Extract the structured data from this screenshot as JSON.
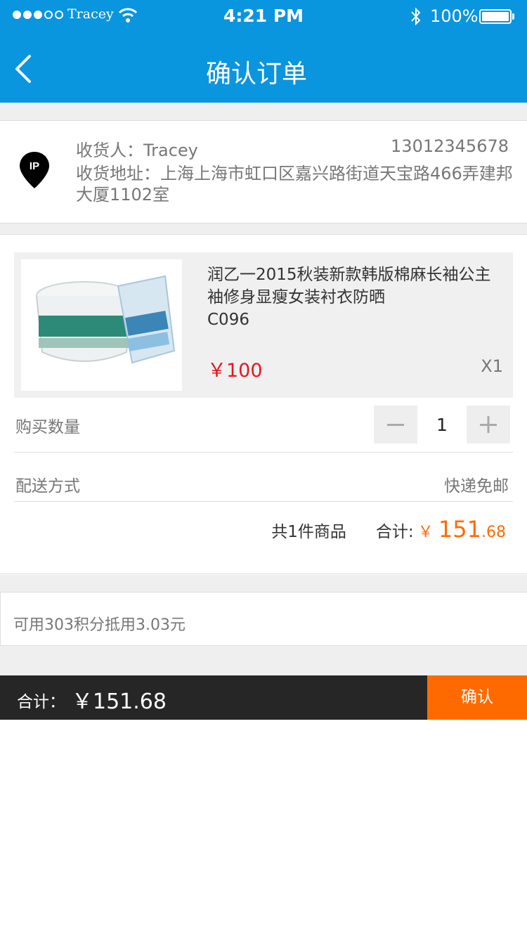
{
  "status_bar": {
    "carrier": "Tracey",
    "time": "4:21 PM",
    "battery": "100%",
    "signal_bars": 3,
    "icons": [
      "signal-icon",
      "wifi-icon",
      "bluetooth-icon",
      "battery-icon"
    ]
  },
  "nav": {
    "title": "确认订单",
    "back_icon": "chevron-left-icon"
  },
  "address": {
    "recipient": "收货人：Tracey",
    "phone": "13012345678",
    "address": "收货地址：上海上海市虹口区嘉兴路街道天宝路466弄建邦大厦1102室",
    "pin_label": "IP"
  },
  "product": {
    "name_line1": "润乙一2015秋装新款韩版棉麻长袖公主",
    "name_line2": "袖修身显瘦女装衬衣防晒",
    "code": "C096",
    "price": "￥100",
    "quantity_label": "X1"
  },
  "quantity_row": {
    "label": "购买数量",
    "value": "1",
    "minus": "−",
    "plus": "+"
  },
  "shipping_row": {
    "label": "配送方式",
    "value": "快递免邮"
  },
  "summary": {
    "count_text": "共1件商品",
    "total_label": "合计:",
    "currency": "￥",
    "total_int": "151",
    "total_dec": ".68"
  },
  "points": {
    "text": "可用303积分抵用3.03元"
  },
  "bottom_bar": {
    "label": "合计：",
    "total": "￥151.68",
    "confirm": "确认"
  },
  "colors": {
    "header": "#0a95df",
    "accent": "#ff6a00",
    "price_red": "#e5161f",
    "bar_dark": "#262626"
  }
}
